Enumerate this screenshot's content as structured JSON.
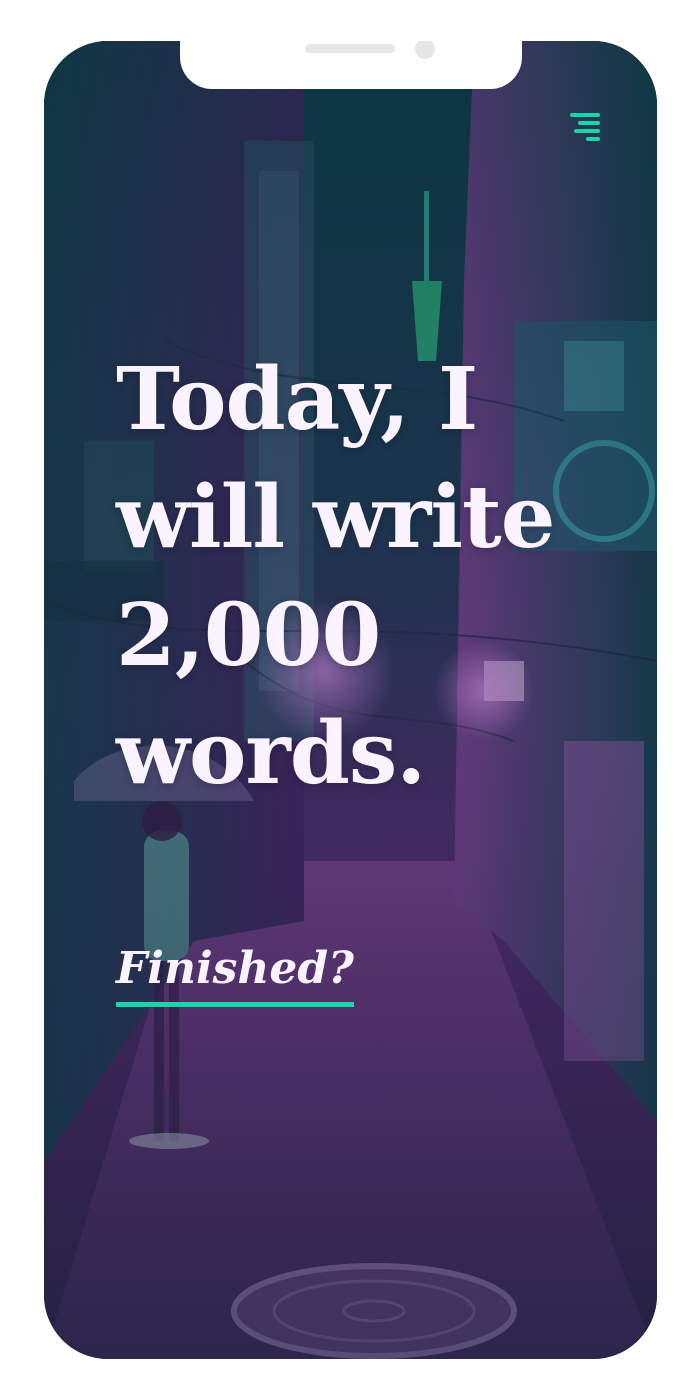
{
  "screen": {
    "headline": "Today, I will write 2,000 words.",
    "finished_link": "Finished?"
  },
  "menu": {
    "icon": "hamburger-menu-icon"
  },
  "colors": {
    "accent": "#19d6a6",
    "text": "#fbf3ff",
    "background_purple": "#5a2d6e",
    "background_teal": "#0f4a52"
  }
}
